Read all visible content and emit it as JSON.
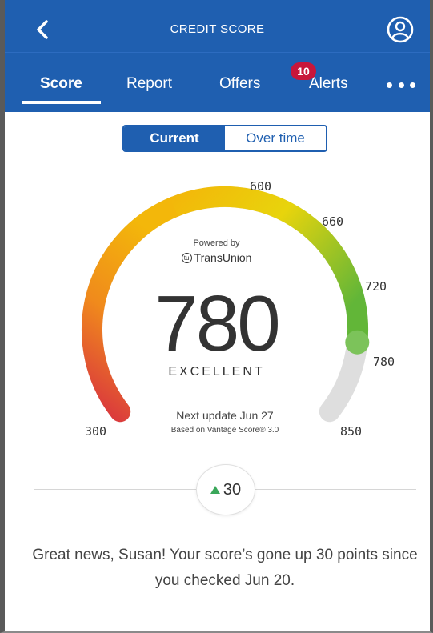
{
  "header": {
    "title": "CREDIT SCORE",
    "back_icon": "chevron-left-icon",
    "profile_icon": "user-circle-icon"
  },
  "tabs": [
    {
      "label": "Score",
      "active": true
    },
    {
      "label": "Report",
      "active": false
    },
    {
      "label": "Offers",
      "active": false
    },
    {
      "label": "Alerts",
      "active": false
    }
  ],
  "alerts_badge": "10",
  "more_icon": "more-horizontal-icon",
  "toggle": {
    "current": "Current",
    "over_time": "Over time",
    "selected": "Current"
  },
  "gauge": {
    "powered_by": "Powered by",
    "provider": "TransUnion",
    "score": "780",
    "rating": "EXCELLENT",
    "ticks": [
      "300",
      "600",
      "660",
      "720",
      "780",
      "850"
    ],
    "min": 300,
    "max": 850,
    "value": 780,
    "next_update": "Next update Jun 27",
    "based_on": "Based on Vantage Score® 3.0"
  },
  "change": {
    "direction": "up",
    "value": "30"
  },
  "message": "Great news, Susan! Your score’s gone up 30 points since you checked Jun 20.",
  "colors": {
    "brand_blue": "#1f5fb0",
    "badge_red": "#c8163a",
    "up_green": "#3aa75a",
    "arc_low": "#d9343f",
    "arc_mid": "#f3b70a",
    "arc_high": "#62b638",
    "arc_track": "#dedede"
  }
}
